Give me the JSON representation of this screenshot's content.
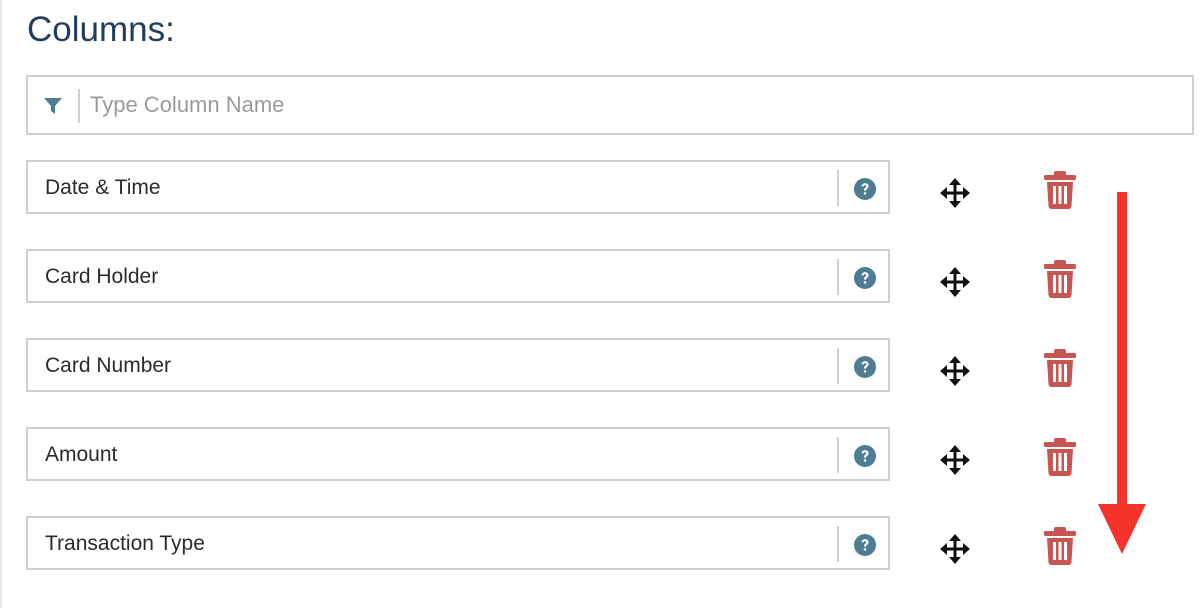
{
  "section": {
    "title": "Columns:"
  },
  "filter": {
    "placeholder": "Type Column Name",
    "value": "",
    "icon": "filter-icon"
  },
  "columns": [
    {
      "label": "Date & Time"
    },
    {
      "label": "Card Holder"
    },
    {
      "label": "Card Number"
    },
    {
      "label": "Amount"
    },
    {
      "label": "Transaction Type"
    }
  ],
  "icons": {
    "help": "question-circle-icon",
    "move": "move-arrows-icon",
    "delete": "trash-icon",
    "annotation": "down-arrow-icon"
  },
  "colors": {
    "title": "#1f3d5c",
    "help": "#4d7c93",
    "trash": "#c75552",
    "arrow": "#f5332a",
    "border": "#cfcfcf"
  }
}
